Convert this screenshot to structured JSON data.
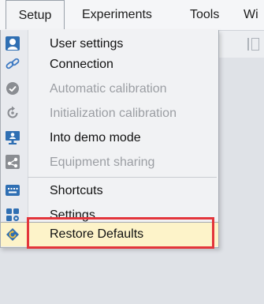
{
  "menubar": {
    "items": [
      {
        "label": "Setup"
      },
      {
        "label": "Experiments"
      },
      {
        "label": "Tools"
      },
      {
        "label": "Wi"
      }
    ]
  },
  "setup_menu": {
    "items": [
      {
        "label": "User settings",
        "icon": "user-icon",
        "enabled": true
      },
      {
        "label": "Connection",
        "icon": "link-icon",
        "enabled": true
      },
      {
        "label": "Automatic calibration",
        "icon": "check-circle-icon",
        "enabled": false
      },
      {
        "label": "Initialization calibration",
        "icon": "reset-icon",
        "enabled": false
      },
      {
        "label": "Into demo mode",
        "icon": "monitor-user-icon",
        "enabled": true
      },
      {
        "label": "Equipment sharing",
        "icon": "share-icon",
        "enabled": false
      },
      {
        "label": "Shortcuts",
        "icon": "keyboard-icon",
        "enabled": true
      },
      {
        "label": "Settings",
        "icon": "grid-settings-icon",
        "enabled": true
      },
      {
        "label": "Restore Defaults",
        "icon": "restore-icon",
        "enabled": true,
        "highlighted": true
      }
    ]
  },
  "colors": {
    "highlight_bg": "#fdf3c9",
    "focus_outline": "#e3353b",
    "icon_blue": "#2f6fb3",
    "disabled_text": "#9b9ea3"
  }
}
